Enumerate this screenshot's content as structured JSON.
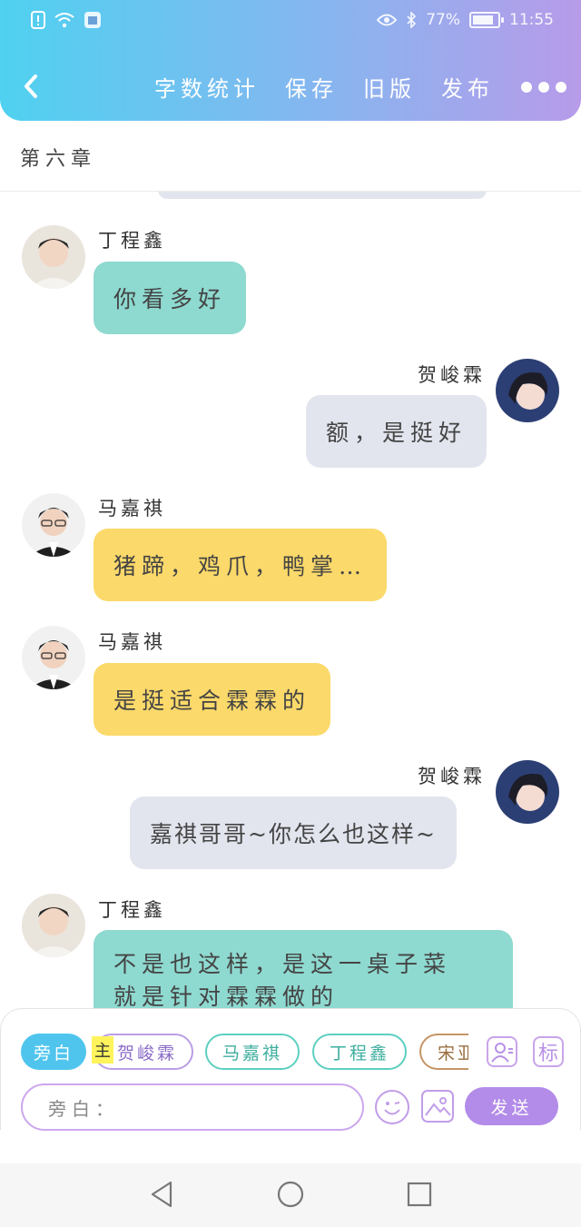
{
  "status_bar": {
    "battery": "77%",
    "time": "11:55"
  },
  "header": {
    "actions": [
      "字数统计",
      "保存",
      "旧版",
      "发布"
    ],
    "gradient_colors": [
      "#4fd1f0",
      "#b79be9"
    ]
  },
  "chapter_title": "第六章",
  "messages": [
    {
      "speaker": "丁程鑫",
      "side": "left",
      "text": "你看多好",
      "bubble_color": "#8ed9d0"
    },
    {
      "speaker": "贺峻霖",
      "side": "right",
      "text": "额，是挺好",
      "bubble_color": "#e2e5ee"
    },
    {
      "speaker": "马嘉祺",
      "side": "left",
      "text": "猪蹄，鸡爪，鸭掌…",
      "bubble_color": "#fbd96a"
    },
    {
      "speaker": "马嘉祺",
      "side": "left",
      "text": "是挺适合霖霖的",
      "bubble_color": "#fbd96a"
    },
    {
      "speaker": "贺峻霖",
      "side": "right",
      "text": "嘉祺哥哥~你怎么也这样~",
      "bubble_color": "#e2e5ee"
    },
    {
      "speaker": "丁程鑫",
      "side": "left",
      "text_line1": "不是也这样，是这一桌子菜",
      "text_line2": "就是针对霖霖做的",
      "bubble_color": "#8ed9d0"
    }
  ],
  "role_chips": {
    "aside": "旁白",
    "main_tag": "主",
    "he": "贺峻霖",
    "ma": "马嘉祺",
    "ding": "丁程鑫",
    "song": "宋亚轩"
  },
  "tools": {
    "label_icon": "标",
    "user_icon": "user-icon"
  },
  "input": {
    "placeholder": "旁白："
  },
  "send_label": "发送"
}
